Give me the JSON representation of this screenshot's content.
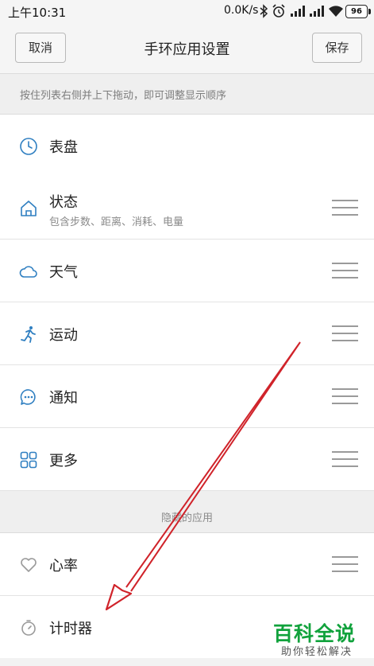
{
  "status_bar": {
    "time": "上午10:31",
    "network_speed": "0.0K/s",
    "battery": "96",
    "icons": [
      "bluetooth-icon",
      "alarm-icon",
      "signal-icon",
      "signal-icon",
      "wifi-icon",
      "battery-icon"
    ]
  },
  "header": {
    "cancel_label": "取消",
    "title": "手环应用设置",
    "save_label": "保存"
  },
  "hint": "按住列表右侧并上下拖动，即可调整显示顺序",
  "visible_apps": [
    {
      "label": "表盘",
      "icon": "watch-face-icon"
    },
    {
      "label": "状态",
      "subtitle": "包含步数、距离、消耗、电量",
      "icon": "home-icon"
    },
    {
      "label": "天气",
      "icon": "cloud-icon"
    },
    {
      "label": "运动",
      "icon": "running-icon"
    },
    {
      "label": "通知",
      "icon": "chat-bubble-icon"
    },
    {
      "label": "更多",
      "icon": "grid-icon"
    }
  ],
  "hidden_section_title": "隐藏的应用",
  "hidden_apps": [
    {
      "label": "心率",
      "icon": "heart-icon"
    },
    {
      "label": "计时器",
      "icon": "stopwatch-icon"
    }
  ],
  "watermark": {
    "title": "百科全说",
    "subtitle": "助你轻松解决"
  },
  "colors": {
    "accent_icon": "#2f7fc1",
    "annotation_arrow": "#d0232a",
    "watermark": "#11a23c"
  }
}
